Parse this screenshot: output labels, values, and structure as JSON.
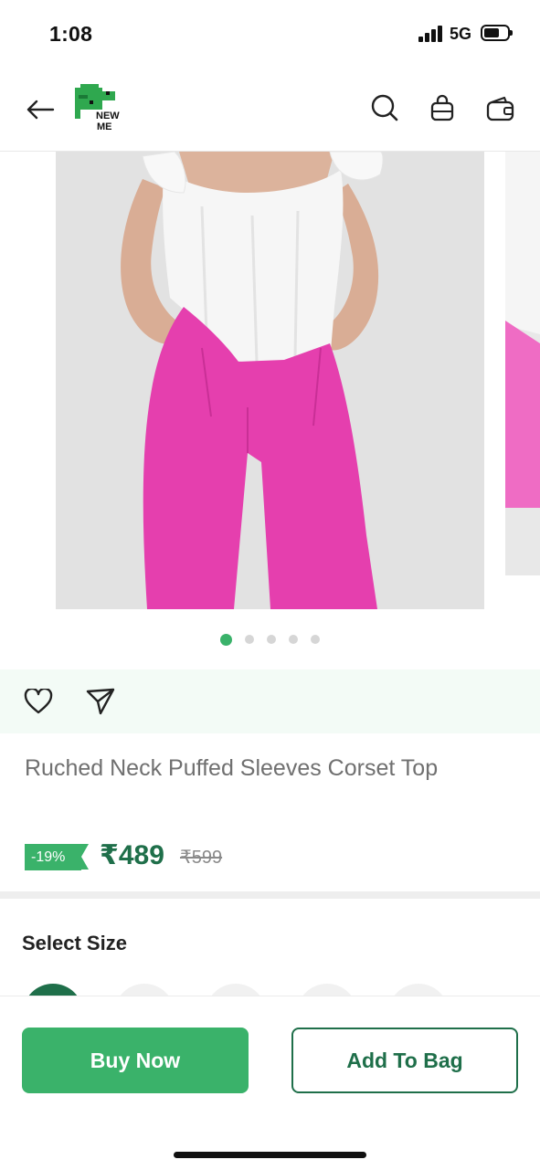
{
  "status_bar": {
    "time": "1:08",
    "network": "5G"
  },
  "header": {
    "logo_text_line1": "NEW",
    "logo_text_line2": "ME",
    "icons": [
      "back-arrow-icon",
      "search-icon",
      "shopping-bag-icon",
      "wallet-icon"
    ]
  },
  "gallery": {
    "total_images": 5,
    "active_index": 0
  },
  "product": {
    "title": "Ruched Neck Puffed Sleeves Corset Top",
    "discount": "-19%",
    "price": "₹489",
    "mrp": "₹599"
  },
  "size_section": {
    "title": "Select Size"
  },
  "bottom_bar": {
    "buy_label": "Buy Now",
    "bag_label": "Add To Bag"
  },
  "colors": {
    "accent": "#3ab26a",
    "dark_green": "#1f6f4a",
    "action_bg": "#f3fbf6",
    "pink": "#e53fae"
  }
}
